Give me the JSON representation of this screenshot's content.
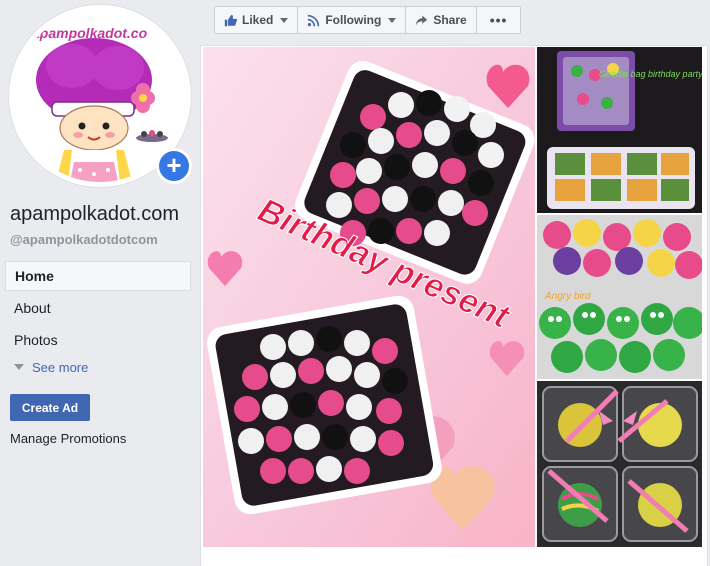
{
  "page": {
    "name": "apampolkadot.com",
    "handle": "@apampolkadotdotcom",
    "logo_text": "apampolkadot.co"
  },
  "nav": {
    "items": [
      {
        "label": "Home",
        "active": true
      },
      {
        "label": "About",
        "active": false
      },
      {
        "label": "Photos",
        "active": false
      }
    ],
    "see_more": "See more"
  },
  "sidebar": {
    "create_ad": "Create Ad",
    "manage_promotions": "Manage Promotions"
  },
  "actions": {
    "liked": "Liked",
    "following": "Following",
    "share": "Share",
    "more": "•••"
  },
  "photos": {
    "main_caption": "Birthday present",
    "thumb1_caption": "Goodie bag birthday party",
    "thumb2_caption": "Angry bird"
  },
  "colors": {
    "accent": "#4267b2",
    "plus_badge": "#3578e5",
    "background": "#e9ebee"
  }
}
